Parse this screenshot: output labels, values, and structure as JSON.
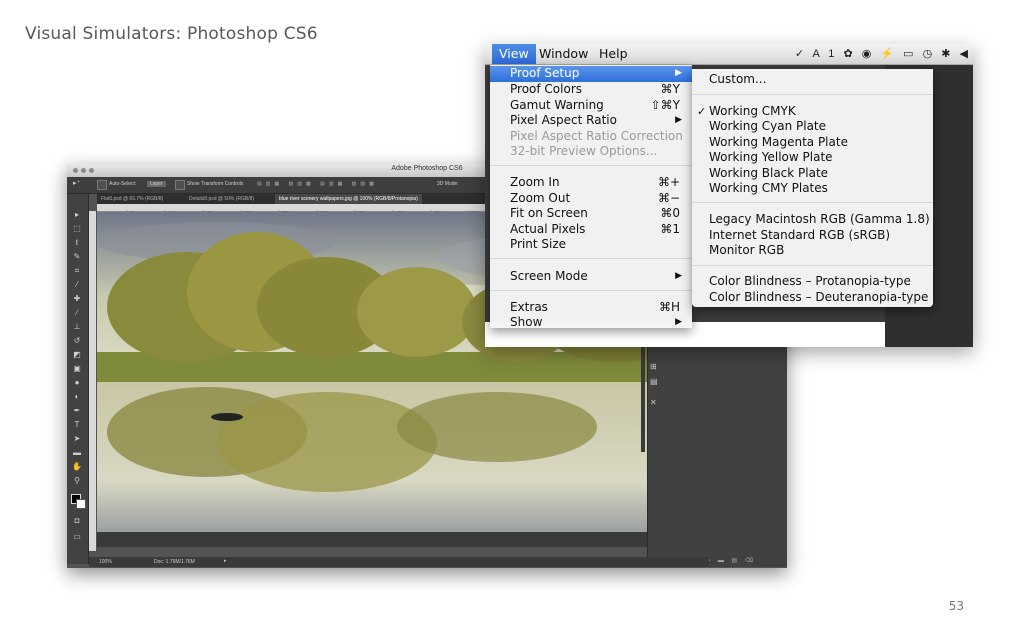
{
  "slide": {
    "title": "Visual Simulators: Photoshop CS6",
    "page_number": "53"
  },
  "photoshop": {
    "window_title": "Adobe Photoshop CS6",
    "options_bar": {
      "auto_select": "Auto-Select:",
      "layer_select": "Layer",
      "show_transform": "Show Transform Controls",
      "mode_3d": "3D Mode:"
    },
    "document_tabs": [
      {
        "label": "Flat0.psd @ 66.7% (RGB/8)",
        "active": false
      },
      {
        "label": "Details8.psd @ 50% (RGB/8)",
        "active": false
      },
      {
        "label": "blue river scenery wallpapers.jpg @ 100% (RGB/8/Protanopia)",
        "active": true
      }
    ],
    "ruler_ticks": [
      "50",
      "100",
      "150",
      "200",
      "250",
      "300",
      "350",
      "400",
      "450",
      "500",
      "550",
      "600",
      "650",
      "700",
      "750"
    ],
    "status": {
      "zoom": "100%",
      "doc": "Doc: 1.76M/1.76M"
    }
  },
  "menubar": {
    "items": [
      "View",
      "Window",
      "Help"
    ],
    "selected": "View",
    "status_icons": "✓ A 1 ✿ ◉ ⚡ ▭ ◷ ✱ ◀"
  },
  "view_menu": {
    "items": [
      {
        "label": "Proof Setup",
        "shortcut": "",
        "submenu": true,
        "highlighted": true,
        "disabled": false
      },
      {
        "label": "Proof Colors",
        "shortcut": "⌘Y",
        "submenu": false,
        "highlighted": false,
        "disabled": false
      },
      {
        "label": "Gamut Warning",
        "shortcut": "⇧⌘Y",
        "submenu": false,
        "highlighted": false,
        "disabled": false
      },
      {
        "label": "Pixel Aspect Ratio",
        "shortcut": "",
        "submenu": true,
        "highlighted": false,
        "disabled": false
      },
      {
        "label": "Pixel Aspect Ratio Correction",
        "shortcut": "",
        "submenu": false,
        "highlighted": false,
        "disabled": true
      },
      {
        "label": "32-bit Preview Options...",
        "shortcut": "",
        "submenu": false,
        "highlighted": false,
        "disabled": true
      },
      {
        "label": "Zoom In",
        "shortcut": "⌘+",
        "submenu": false,
        "highlighted": false,
        "disabled": false
      },
      {
        "label": "Zoom Out",
        "shortcut": "⌘−",
        "submenu": false,
        "highlighted": false,
        "disabled": false
      },
      {
        "label": "Fit on Screen",
        "shortcut": "⌘0",
        "submenu": false,
        "highlighted": false,
        "disabled": false
      },
      {
        "label": "Actual Pixels",
        "shortcut": "⌘1",
        "submenu": false,
        "highlighted": false,
        "disabled": false
      },
      {
        "label": "Print Size",
        "shortcut": "",
        "submenu": false,
        "highlighted": false,
        "disabled": false
      },
      {
        "label": "Screen Mode",
        "shortcut": "",
        "submenu": true,
        "highlighted": false,
        "disabled": false
      },
      {
        "label": "Extras",
        "shortcut": "⌘H",
        "submenu": false,
        "highlighted": false,
        "disabled": false
      },
      {
        "label": "Show",
        "shortcut": "",
        "submenu": true,
        "highlighted": false,
        "disabled": false
      }
    ]
  },
  "proof_setup_submenu": {
    "items": [
      {
        "label": "Custom...",
        "checked": false
      },
      {
        "label": "Working CMYK",
        "checked": true
      },
      {
        "label": "Working Cyan Plate",
        "checked": false
      },
      {
        "label": "Working Magenta Plate",
        "checked": false
      },
      {
        "label": "Working Yellow Plate",
        "checked": false
      },
      {
        "label": "Working Black Plate",
        "checked": false
      },
      {
        "label": "Working CMY Plates",
        "checked": false
      },
      {
        "label": "Legacy Macintosh RGB (Gamma 1.8)",
        "checked": false
      },
      {
        "label": "Internet Standard RGB (sRGB)",
        "checked": false
      },
      {
        "label": "Monitor RGB",
        "checked": false
      },
      {
        "label": "Color Blindness – Protanopia-type",
        "checked": false
      },
      {
        "label": "Color Blindness – Deuteranopia-type",
        "checked": false
      }
    ]
  },
  "colors": {
    "menu_highlight": "#3a7be0",
    "ps_chrome": "#535353"
  }
}
